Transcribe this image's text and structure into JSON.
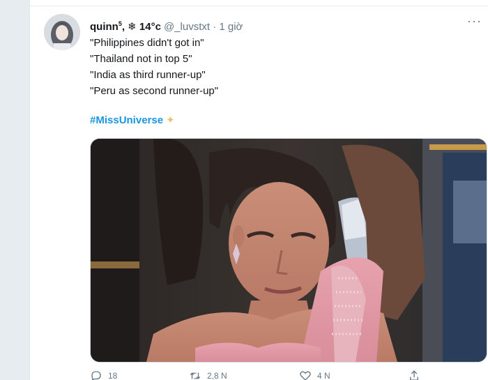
{
  "tweet": {
    "display_name": "quinn",
    "display_name_sup": "5",
    "display_name_suffix": ", ❄︎ 14°c",
    "handle": "@_luvstxt · 1 giờ",
    "more_label": "···",
    "lines": [
      "\"Philippines didn't got in\"",
      "\"Thailand not in top 5\"",
      "\"India as third runner-up\"",
      "\"Peru as second runner-up\""
    ],
    "hashtag": "#MissUniverse",
    "sparkle": "✦"
  },
  "actions": {
    "reply": {
      "icon": "reply-icon",
      "count": "18"
    },
    "retweet": {
      "icon": "retweet-icon",
      "count": "2,8 N"
    },
    "like": {
      "icon": "heart-icon",
      "count": "4 N"
    },
    "share": {
      "icon": "share-icon"
    }
  }
}
